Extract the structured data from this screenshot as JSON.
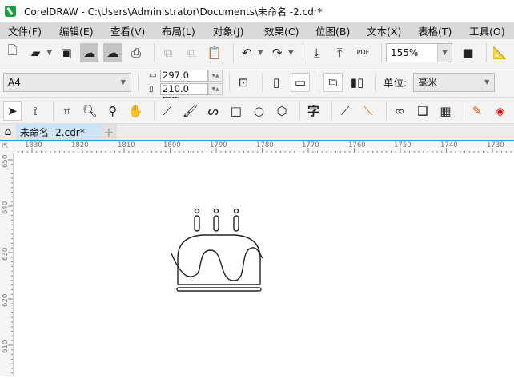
{
  "window": {
    "title": "CorelDRAW - C:\\Users\\Administrator\\Documents\\未命名 -2.cdr*"
  },
  "menu": [
    "文件(F)",
    "编辑(E)",
    "查看(V)",
    "布局(L)",
    "对象(J)",
    "效果(C)",
    "位图(B)",
    "文本(X)",
    "表格(T)",
    "工具(O)"
  ],
  "toolbar": {
    "zoom": "155%",
    "pdf_label": "PDF"
  },
  "property_bar": {
    "page_size": "A4",
    "width": "297.0 mm",
    "height": "210.0 mm",
    "units_label": "单位:",
    "units": "毫米"
  },
  "toolbox": {
    "text_tool": "字"
  },
  "tabs": [
    {
      "label": "未命名 -2.cdr*"
    }
  ],
  "rulers": {
    "horizontal": [
      "1830",
      "1820",
      "1810",
      "1800",
      "1790",
      "1780",
      "1770",
      "1760",
      "1750",
      "1740",
      "1730"
    ],
    "vertical": [
      "650",
      "640",
      "630",
      "620",
      "610"
    ]
  }
}
